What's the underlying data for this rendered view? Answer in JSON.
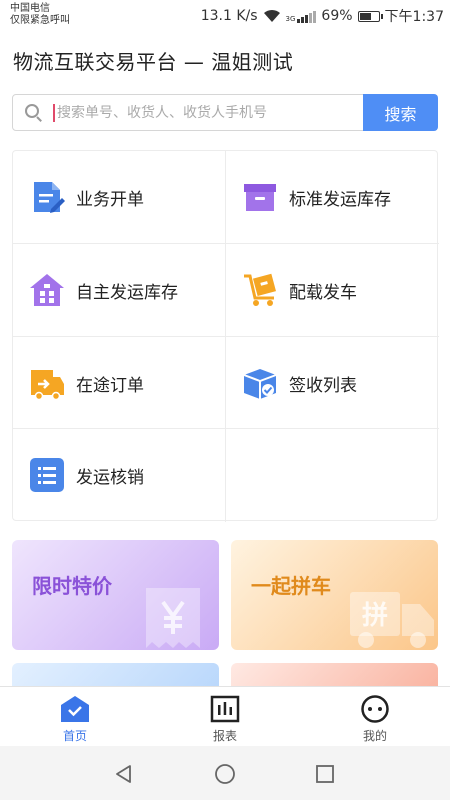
{
  "status_bar": {
    "carrier_line1": "中国电信",
    "carrier_line2": "仅限紧急呼叫",
    "speed": "13.1 K/s",
    "network": "3G",
    "battery": "69%",
    "battery_level": 0.69,
    "time": "下午1:37"
  },
  "header": {
    "title": "物流互联交易平台 — 温姐测试"
  },
  "search": {
    "placeholder": "搜索单号、收货人、收货人手机号",
    "value": "",
    "button_label": "搜索"
  },
  "menu": {
    "items": [
      {
        "label": "业务开单",
        "icon": "document-edit-icon"
      },
      {
        "label": "标准发运库存",
        "icon": "storage-box-icon"
      },
      {
        "label": "自主发运库存",
        "icon": "warehouse-icon"
      },
      {
        "label": "配载发车",
        "icon": "cart-loading-icon"
      },
      {
        "label": "在途订单",
        "icon": "truck-arrow-icon"
      },
      {
        "label": "签收列表",
        "icon": "signed-box-icon"
      },
      {
        "label": "发运核销",
        "icon": "list-icon"
      }
    ]
  },
  "promos": [
    {
      "label": "限时特价",
      "icon": "yen-receipt-icon"
    },
    {
      "label": "一起拼车",
      "icon": "pin-truck-icon",
      "icon_text": "拼"
    }
  ],
  "tabbar": {
    "tabs": [
      {
        "label": "首页",
        "icon": "home-icon",
        "active": true
      },
      {
        "label": "报表",
        "icon": "report-icon",
        "active": false
      },
      {
        "label": "我的",
        "icon": "profile-icon",
        "active": false
      }
    ]
  },
  "colors": {
    "accent": "#4f8ef5",
    "active_tab": "#3a75e8",
    "purple": "#9b6be8",
    "orange": "#f5a623",
    "blue": "#4a86e8"
  }
}
